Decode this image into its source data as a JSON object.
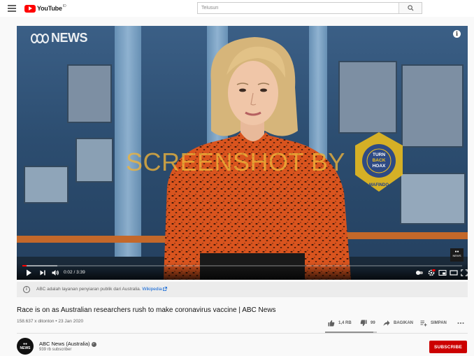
{
  "header": {
    "logo_word": "YouTube",
    "logo_region": "ID",
    "search_placeholder": "Telusuri"
  },
  "player": {
    "channel_logo_text": "NEWS",
    "watermark_text": "SCREENSHOT BY",
    "seal": {
      "ring_text": "MASYARAKAT ANTI FITNAH INDONESIA",
      "center_lines": [
        "TURN",
        "BACK",
        "HOAX"
      ],
      "bottom_text": "MAFINDO"
    },
    "news_badge_text": "NEWS",
    "current_time": "0:02",
    "duration": "3:39",
    "time_display": "0:02 / 3:39",
    "progress_played": 0.009,
    "progress_loaded": 0.08
  },
  "info_card": {
    "text": "ABC adalah layanan penyiaran publik dari Australia.",
    "link": "Wikipedia"
  },
  "video": {
    "title": "Race is on as Australian researchers rush to make coronavirus vaccine | ABC News",
    "meta": "158.637 x ditonton • 23 Jan 2020",
    "likes": "1,4 RB",
    "dislikes": "99",
    "share_label": "BAGIKAN",
    "save_label": "SIMPAN",
    "like_ratio": 0.93
  },
  "channel": {
    "name": "ABC News (Australia)",
    "subscribers": "939 rb subscriber",
    "avatar_text": "NEWS",
    "subscribe_label": "SUBSCRIBE"
  },
  "colors": {
    "brand_red": "#ff0000",
    "subscribe_red": "#cc0000",
    "link_blue": "#065fd4",
    "watermark_gold": "#f0b43a"
  }
}
